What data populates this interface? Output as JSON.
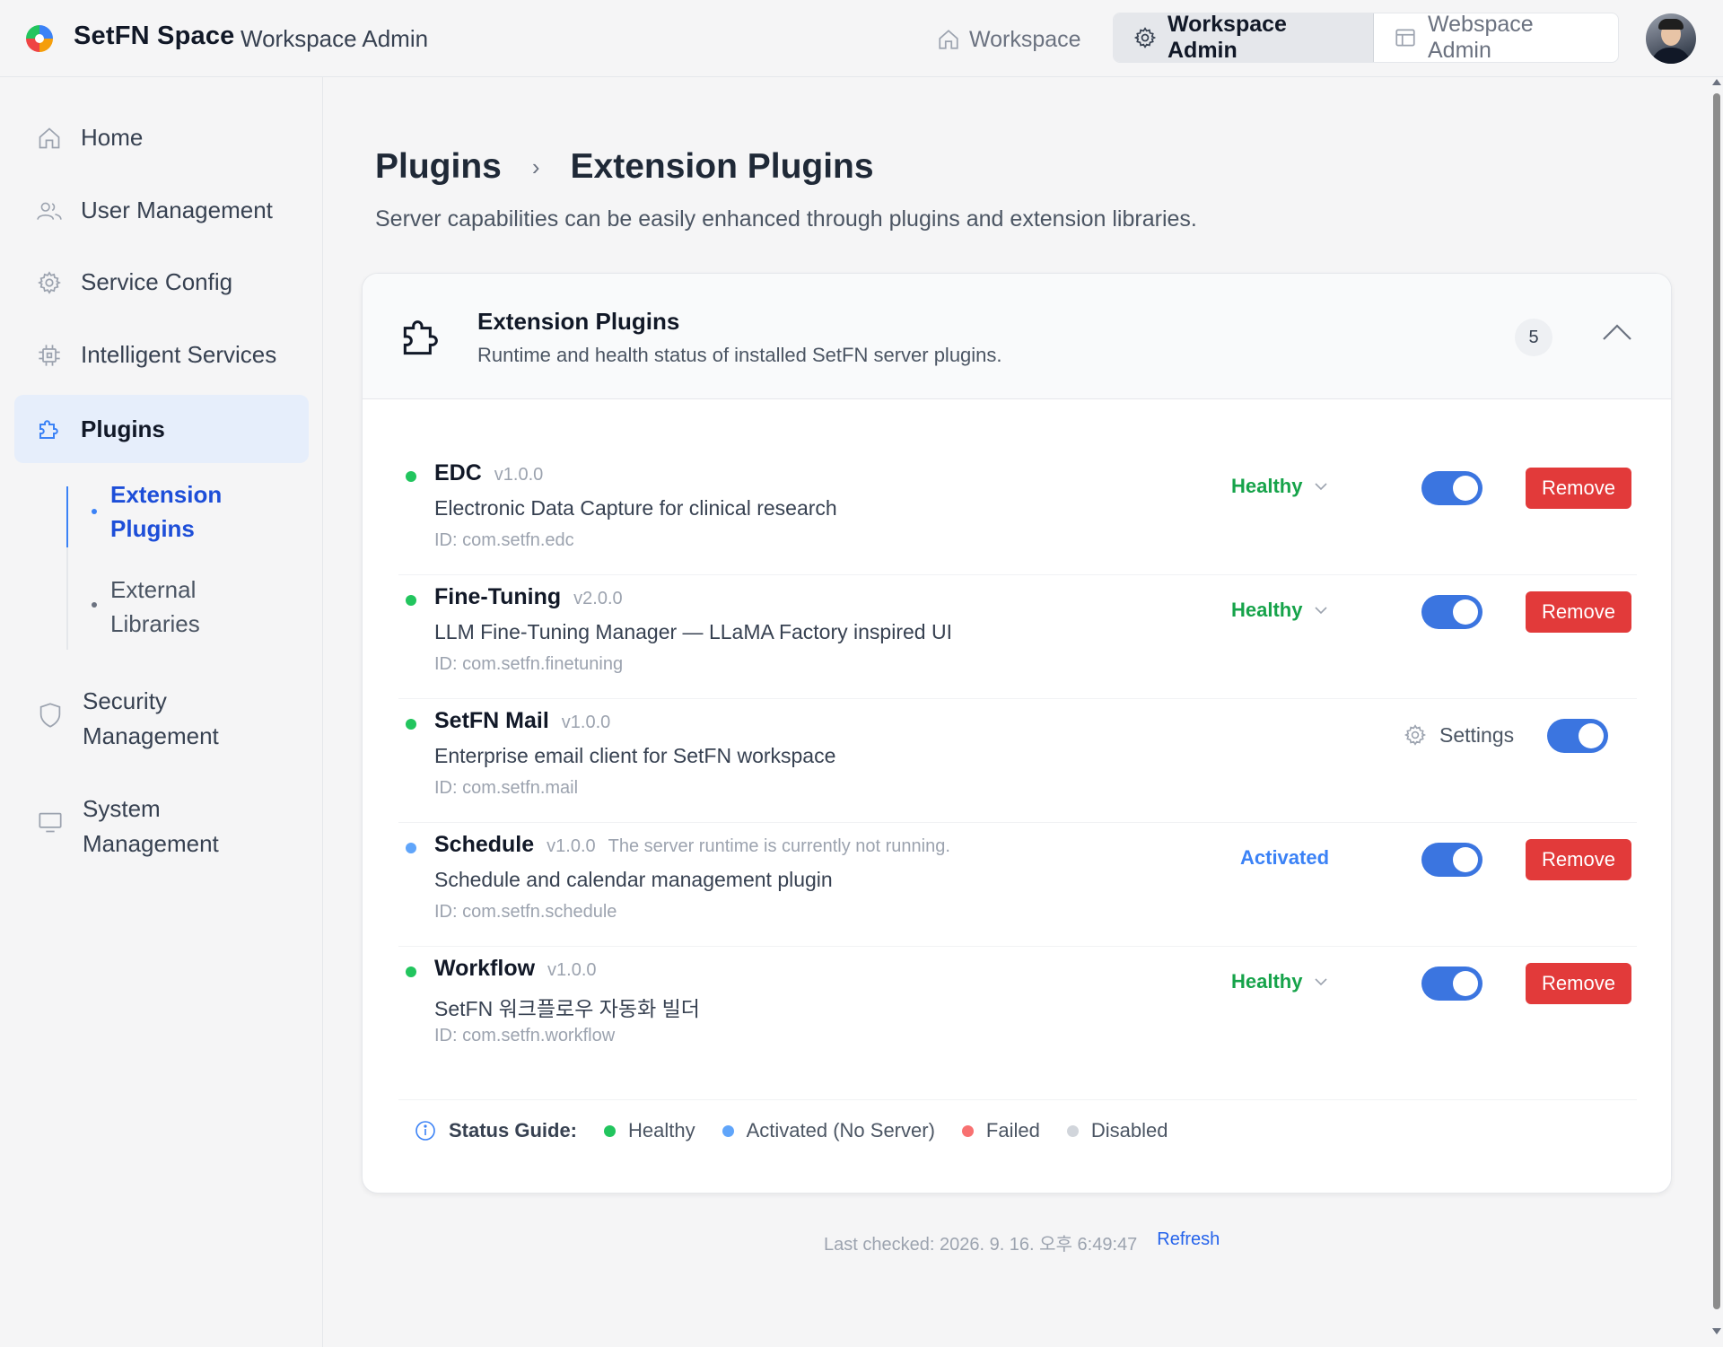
{
  "app": {
    "brand": "SetFN Space",
    "subtitle": "Workspace Admin"
  },
  "topnav": {
    "workspace_label": "Workspace",
    "workspace_admin_label": "Workspace Admin",
    "webspace_admin_label": "Webspace Admin"
  },
  "sidebar": {
    "items": [
      {
        "label": "Home",
        "icon": "home-icon"
      },
      {
        "label": "User Management",
        "icon": "users-icon"
      },
      {
        "label": "Service Config",
        "icon": "gear-icon"
      },
      {
        "label": "Intelligent Services",
        "icon": "chip-icon"
      },
      {
        "label": "Plugins",
        "icon": "puzzle-icon",
        "active": true
      }
    ],
    "subitems": [
      {
        "label": "Extension Plugins",
        "active": true
      },
      {
        "label": "External Libraries",
        "active": false
      }
    ],
    "security_label": "Security Management",
    "system_label": "System Management"
  },
  "page": {
    "breadcrumb_parent": "Plugins",
    "breadcrumb_current": "Extension Plugins",
    "description": "Server capabilities can be easily enhanced through plugins and extension libraries."
  },
  "card": {
    "title": "Extension Plugins",
    "subtitle": "Runtime and health status of installed SetFN server plugins.",
    "count": "5"
  },
  "plugins": [
    {
      "name": "EDC",
      "version": "v1.0.0",
      "note": "",
      "description": "Electronic Data Capture for clinical research",
      "id": "ID: com.setfn.edc",
      "status": "Healthy",
      "status_color": "#16a34a",
      "enabled": true,
      "action": "Remove"
    },
    {
      "name": "Fine-Tuning",
      "version": "v2.0.0",
      "note": "",
      "description": "LLM Fine-Tuning Manager — LLaMA Factory inspired UI",
      "id": "ID: com.setfn.finetuning",
      "status": "Healthy",
      "status_color": "#16a34a",
      "enabled": true,
      "action": "Remove"
    },
    {
      "name": "SetFN Mail",
      "version": "v1.0.0",
      "note": "",
      "description": "Enterprise email client for SetFN workspace",
      "id": "ID: com.setfn.mail",
      "status": "",
      "status_color": "#16a34a",
      "enabled": true,
      "action": "Settings"
    },
    {
      "name": "Schedule",
      "version": "v1.0.0",
      "note": "The server runtime is currently not running.",
      "description": "Schedule and calendar management plugin",
      "id": "ID: com.setfn.schedule",
      "status": "Activated",
      "status_color": "#3b82f6",
      "enabled": true,
      "action": "Remove"
    },
    {
      "name": "Workflow",
      "version": "v1.0.0",
      "note": "",
      "description": "SetFN 워크플로우 자동화 빌더",
      "id": "ID: com.setfn.workflow",
      "status": "Healthy",
      "status_color": "#16a34a",
      "enabled": true,
      "action": "Remove"
    }
  ],
  "status_guide": {
    "title": "Status Guide:",
    "items": [
      {
        "label": "Healthy",
        "color": "#22c55e"
      },
      {
        "label": "Activated (No Server)",
        "color": "#60a5fa"
      },
      {
        "label": "Failed",
        "color": "#f87171"
      },
      {
        "label": "Disabled",
        "color": "#d1d5db"
      }
    ]
  },
  "footer": {
    "last_checked": "Last checked: 2026. 9. 16. 오후 6:49:47",
    "refresh_label": "Refresh"
  },
  "colors": {
    "accent": "#3b75e0",
    "danger": "#e23a3a",
    "healthy": "#16a34a"
  }
}
